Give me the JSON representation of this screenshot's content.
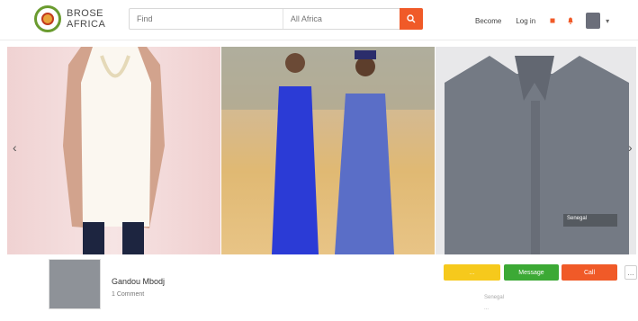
{
  "brand": {
    "name_line1": "BROSE",
    "name_line2": "AFRICA"
  },
  "search": {
    "query_placeholder": "Find",
    "location_placeholder": "All Africa"
  },
  "nav": {
    "link1": "Become",
    "link2": "Log in"
  },
  "carousel": {
    "prev_glyph": "‹",
    "next_glyph": "›",
    "tag_text": "Senegal"
  },
  "product": {
    "name": "Gandou Mbodj",
    "price": "1 Comment"
  },
  "actions": {
    "yellow_label": "...",
    "green_label": "Message",
    "orange_label": "Call",
    "more_glyph": "…"
  },
  "info": {
    "line1": "Senegal",
    "line2": "..."
  },
  "colors": {
    "accent": "#f05a28",
    "green": "#3ca935",
    "yellow": "#f6c91c"
  }
}
